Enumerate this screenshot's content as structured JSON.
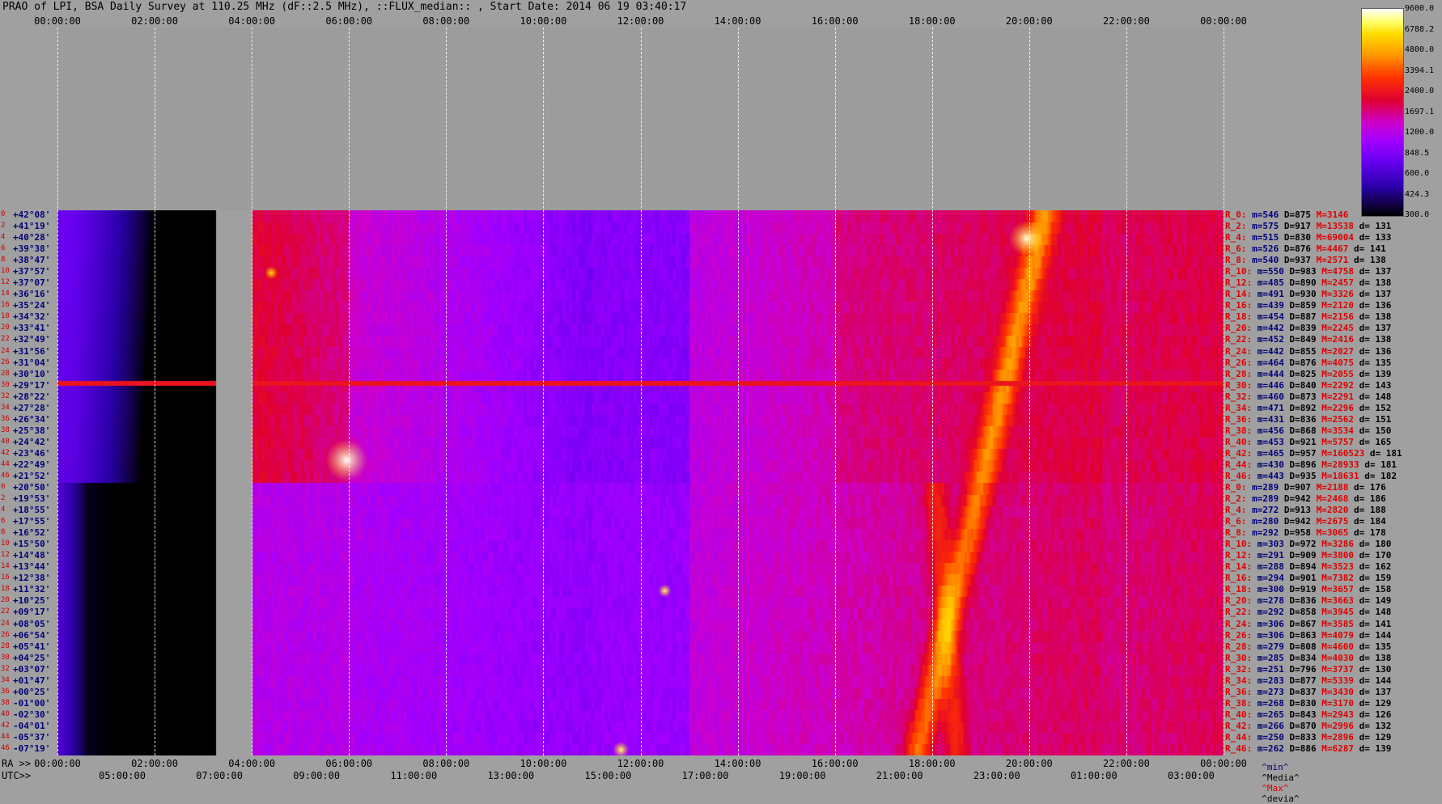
{
  "title": "PRAO of LPI, BSA Daily Survey at 110.25 MHz (dF::2.5 MHz), ::FLUX_median:: , Start Date: 2014 06 19 03:40:17",
  "utc_top": [
    "00:00:00",
    "02:00:00",
    "04:00:00",
    "06:00:00",
    "08:00:00",
    "10:00:00",
    "12:00:00",
    "14:00:00",
    "16:00:00",
    "18:00:00",
    "20:00:00",
    "22:00:00",
    "00:00:00"
  ],
  "ra_axis_name": "RA >>",
  "utc_axis_name": "UTC>>",
  "ra_bottom": [
    "00:00:00",
    "02:00:00",
    "04:00:00",
    "06:00:00",
    "08:00:00",
    "10:00:00",
    "12:00:00",
    "14:00:00",
    "16:00:00",
    "18:00:00",
    "20:00:00",
    "22:00:00",
    "00:00:00"
  ],
  "utc_bottom": [
    "05:00:00",
    "07:00:00",
    "09:00:00",
    "11:00:00",
    "13:00:00",
    "15:00:00",
    "17:00:00",
    "19:00:00",
    "21:00:00",
    "23:00:00",
    "01:00:00",
    "03:00:00"
  ],
  "colorbar": {
    "levels": [
      "9600.0",
      "6788.2",
      "4800.0",
      "3394.1",
      "2400.0",
      "1697.1",
      "1200.0",
      "848.5",
      "600.0",
      "424.3",
      "300.0"
    ],
    "scale": "log"
  },
  "rows": [
    {
      "num": "0",
      "dec": "+42°08'",
      "r": "R_0:",
      "m": "m=546",
      "D": "D=875",
      "M": "M=3146",
      "d": ""
    },
    {
      "num": "2",
      "dec": "+41°19'",
      "r": "R_2:",
      "m": "m=575",
      "D": "D=917",
      "M": "M=13538",
      "d": "d= 131"
    },
    {
      "num": "4",
      "dec": "+40°28'",
      "r": "R_4:",
      "m": "m=515",
      "D": "D=830",
      "M": "M=69004",
      "d": "d= 133"
    },
    {
      "num": "6",
      "dec": "+39°38'",
      "r": "R_6:",
      "m": "m=526",
      "D": "D=876",
      "M": "M=4467",
      "d": "d= 141"
    },
    {
      "num": "8",
      "dec": "+38°47'",
      "r": "R_8:",
      "m": "m=540",
      "D": "D=937",
      "M": "M=2571",
      "d": "d= 138"
    },
    {
      "num": "10",
      "dec": "+37°57'",
      "r": "R_10:",
      "m": "m=550",
      "D": "D=983",
      "M": "M=4758",
      "d": "d= 137"
    },
    {
      "num": "12",
      "dec": "+37°07'",
      "r": "R_12:",
      "m": "m=485",
      "D": "D=890",
      "M": "M=2457",
      "d": "d= 138"
    },
    {
      "num": "14",
      "dec": "+36°16'",
      "r": "R_14:",
      "m": "m=491",
      "D": "D=930",
      "M": "M=3326",
      "d": "d= 137"
    },
    {
      "num": "16",
      "dec": "+35°24'",
      "r": "R_16:",
      "m": "m=439",
      "D": "D=859",
      "M": "M=2120",
      "d": "d= 136"
    },
    {
      "num": "18",
      "dec": "+34°32'",
      "r": "R_18:",
      "m": "m=454",
      "D": "D=887",
      "M": "M=2156",
      "d": "d= 138"
    },
    {
      "num": "20",
      "dec": "+33°41'",
      "r": "R_20:",
      "m": "m=442",
      "D": "D=839",
      "M": "M=2245",
      "d": "d= 137"
    },
    {
      "num": "22",
      "dec": "+32°49'",
      "r": "R_22:",
      "m": "m=452",
      "D": "D=849",
      "M": "M=2416",
      "d": "d= 138"
    },
    {
      "num": "24",
      "dec": "+31°56'",
      "r": "R_24:",
      "m": "m=442",
      "D": "D=855",
      "M": "M=2027",
      "d": "d= 136"
    },
    {
      "num": "26",
      "dec": "+31°04'",
      "r": "R_26:",
      "m": "m=464",
      "D": "D=876",
      "M": "M=4075",
      "d": "d= 135"
    },
    {
      "num": "28",
      "dec": "+30°10'",
      "r": "R_28:",
      "m": "m=444",
      "D": "D=825",
      "M": "M=2055",
      "d": "d= 139"
    },
    {
      "num": "30",
      "dec": "+29°17'",
      "r": "R_30:",
      "m": "m=446",
      "D": "D=840",
      "M": "M=2292",
      "d": "d= 143"
    },
    {
      "num": "32",
      "dec": "+28°22'",
      "r": "R_32:",
      "m": "m=460",
      "D": "D=873",
      "M": "M=2291",
      "d": "d= 148"
    },
    {
      "num": "34",
      "dec": "+27°28'",
      "r": "R_34:",
      "m": "m=471",
      "D": "D=892",
      "M": "M=2296",
      "d": "d= 152"
    },
    {
      "num": "36",
      "dec": "+26°34'",
      "r": "R_36:",
      "m": "m=431",
      "D": "D=836",
      "M": "M=2562",
      "d": "d= 151"
    },
    {
      "num": "38",
      "dec": "+25°38'",
      "r": "R_38:",
      "m": "m=456",
      "D": "D=868",
      "M": "M=3534",
      "d": "d= 150"
    },
    {
      "num": "40",
      "dec": "+24°42'",
      "r": "R_40:",
      "m": "m=453",
      "D": "D=921",
      "M": "M=5757",
      "d": "d= 165"
    },
    {
      "num": "42",
      "dec": "+23°46'",
      "r": "R_42:",
      "m": "m=465",
      "D": "D=957",
      "M": "M=160523",
      "d": "d= 181"
    },
    {
      "num": "44",
      "dec": "+22°49'",
      "r": "R_44:",
      "m": "m=430",
      "D": "D=896",
      "M": "M=28933",
      "d": "d= 181"
    },
    {
      "num": "46",
      "dec": "+21°52'",
      "r": "R_46:",
      "m": "m=443",
      "D": "D=935",
      "M": "M=18631",
      "d": "d= 182"
    },
    {
      "num": "0",
      "dec": "+20°50'",
      "r": "R_0:",
      "m": "m=289",
      "D": "D=907",
      "M": "M=2188",
      "d": "d= 176"
    },
    {
      "num": "2",
      "dec": "+19°53'",
      "r": "R_2:",
      "m": "m=289",
      "D": "D=942",
      "M": "M=2468",
      "d": "d= 186"
    },
    {
      "num": "4",
      "dec": "+18°55'",
      "r": "R_4:",
      "m": "m=272",
      "D": "D=913",
      "M": "M=2820",
      "d": "d= 188"
    },
    {
      "num": "6",
      "dec": "+17°55'",
      "r": "R_6:",
      "m": "m=280",
      "D": "D=942",
      "M": "M=2675",
      "d": "d= 184"
    },
    {
      "num": "8",
      "dec": "+16°52'",
      "r": "R_8:",
      "m": "m=292",
      "D": "D=958",
      "M": "M=3065",
      "d": "d= 178"
    },
    {
      "num": "10",
      "dec": "+15°50'",
      "r": "R_10:",
      "m": "m=303",
      "D": "D=972",
      "M": "M=3286",
      "d": "d= 180"
    },
    {
      "num": "12",
      "dec": "+14°48'",
      "r": "R_12:",
      "m": "m=291",
      "D": "D=909",
      "M": "M=3800",
      "d": "d= 170"
    },
    {
      "num": "14",
      "dec": "+13°44'",
      "r": "R_14:",
      "m": "m=288",
      "D": "D=894",
      "M": "M=3523",
      "d": "d= 162"
    },
    {
      "num": "16",
      "dec": "+12°38'",
      "r": "R_16:",
      "m": "m=294",
      "D": "D=901",
      "M": "M=7382",
      "d": "d= 159"
    },
    {
      "num": "18",
      "dec": "+11°32'",
      "r": "R_18:",
      "m": "m=300",
      "D": "D=919",
      "M": "M=3657",
      "d": "d= 158"
    },
    {
      "num": "20",
      "dec": "+10°25'",
      "r": "R_20:",
      "m": "m=278",
      "D": "D=836",
      "M": "M=3663",
      "d": "d= 149"
    },
    {
      "num": "22",
      "dec": "+09°17'",
      "r": "R_22:",
      "m": "m=292",
      "D": "D=858",
      "M": "M=3945",
      "d": "d= 148"
    },
    {
      "num": "24",
      "dec": "+08°05'",
      "r": "R_24:",
      "m": "m=306",
      "D": "D=867",
      "M": "M=3585",
      "d": "d= 141"
    },
    {
      "num": "26",
      "dec": "+06°54'",
      "r": "R_26:",
      "m": "m=306",
      "D": "D=863",
      "M": "M=4079",
      "d": "d= 144"
    },
    {
      "num": "28",
      "dec": "+05°41'",
      "r": "R_28:",
      "m": "m=279",
      "D": "D=808",
      "M": "M=4600",
      "d": "d= 135"
    },
    {
      "num": "30",
      "dec": "+04°25'",
      "r": "R_30:",
      "m": "m=285",
      "D": "D=834",
      "M": "M=4030",
      "d": "d= 138"
    },
    {
      "num": "32",
      "dec": "+03°07'",
      "r": "R_32:",
      "m": "m=251",
      "D": "D=796",
      "M": "M=3737",
      "d": "d= 130"
    },
    {
      "num": "34",
      "dec": "+01°47'",
      "r": "R_34:",
      "m": "m=283",
      "D": "D=877",
      "M": "M=5339",
      "d": "d= 144"
    },
    {
      "num": "36",
      "dec": "+00°25'",
      "r": "R_36:",
      "m": "m=273",
      "D": "D=837",
      "M": "M=3430",
      "d": "d= 137"
    },
    {
      "num": "38",
      "dec": "-01°00'",
      "r": "R_38:",
      "m": "m=268",
      "D": "D=830",
      "M": "M=3170",
      "d": "d= 129"
    },
    {
      "num": "40",
      "dec": "-02°30'",
      "r": "R_40:",
      "m": "m=265",
      "D": "D=843",
      "M": "M=2943",
      "d": "d= 126"
    },
    {
      "num": "42",
      "dec": "-04°01'",
      "r": "R_42:",
      "m": "m=266",
      "D": "D=870",
      "M": "M=2996",
      "d": "d= 132"
    },
    {
      "num": "44",
      "dec": "-05°37'",
      "r": "R_44:",
      "m": "m=250",
      "D": "D=833",
      "M": "M=2896",
      "d": "d= 129"
    },
    {
      "num": "46",
      "dec": "-07°19'",
      "r": "R_46:",
      "m": "m=262",
      "D": "D=886",
      "M": "M=6287",
      "d": "d= 139"
    }
  ],
  "stat_legend": [
    "^min^",
    "^Media^",
    "^Max^",
    "^devia^"
  ],
  "chart_data": {
    "type": "heatmap",
    "title": "PRAO of LPI, BSA Daily Survey at 110.25 MHz (dF::2.5 MHz), ::FLUX_median:: , Start Date: 2014 06 19 03:40:17",
    "x_axis": "RA 00:00:00 – 24:00:00 (UTC 03:40 – 03:40)",
    "y_axis": "Declination +42°08' to -07°19' (48 beams)",
    "value_range": [
      300,
      9600
    ],
    "scale": "log",
    "data_gap_ra_hours": [
      3.25,
      4.0
    ],
    "notable_features": [
      "Galactic plane crossing RA ~18h–20h40m",
      "Bright source near RA 20h, Dec +40°",
      "Bright source near RA 06h, Dec +23°",
      "Horizontal interference band at Dec +30°10'"
    ]
  }
}
